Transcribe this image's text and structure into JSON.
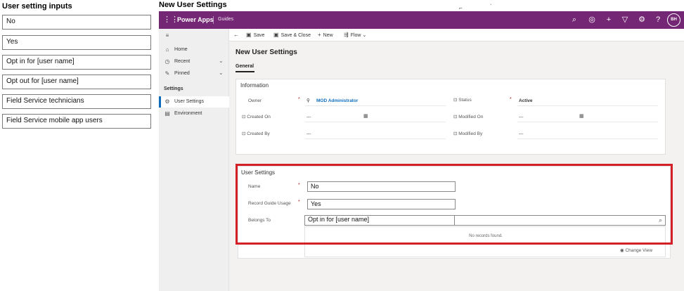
{
  "left_panel": {
    "title": "User setting inputs",
    "options": [
      "No",
      "Yes",
      "Opt in for [user name]",
      "Opt out for [user name]",
      "Field Service technicians",
      "Field Service mobile app users"
    ]
  },
  "right_title": "New User Settings",
  "topbar": {
    "app_name": "Power Apps",
    "sub_name": "Guides",
    "avatar_initials": "BH",
    "icons": [
      "search-icon",
      "circle-check-icon",
      "plus-icon",
      "filter-icon",
      "gear-icon",
      "help-icon"
    ]
  },
  "sidebar": {
    "home": "Home",
    "recent": "Recent",
    "pinned": "Pinned",
    "settings_heading": "Settings",
    "user_settings": "User Settings",
    "environment": "Environment"
  },
  "commands": {
    "save": "Save",
    "save_close": "Save & Close",
    "new": "New",
    "flow": "Flow"
  },
  "form": {
    "title": "New User Settings",
    "tab": "General",
    "information": {
      "title": "Information",
      "owner_label": "Owner",
      "owner_value": "MOD Administrator",
      "status_label": "Status",
      "status_value": "Active",
      "created_on_label": "Created On",
      "created_on_value": "---",
      "modified_on_label": "Modified On",
      "modified_on_value": "---",
      "created_by_label": "Created By",
      "created_by_value": "---",
      "modified_by_label": "Modified By",
      "modified_by_value": "---"
    },
    "user_settings": {
      "title": "User Settings",
      "name_label": "Name",
      "name_value": "No",
      "record_usage_label": "Record Guide Usage",
      "record_usage_value": "Yes",
      "belongs_to_label": "Belongs To",
      "belongs_to_value": "Opt in for [user name]",
      "no_records": "No records found.",
      "change_view": "Change View"
    }
  },
  "colors": {
    "topbar": "#742774",
    "highlight": "#d42027",
    "link": "#0f6cbd"
  }
}
